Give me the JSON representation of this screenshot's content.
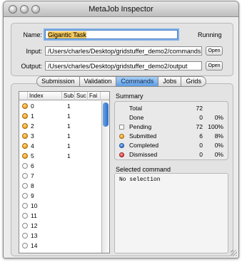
{
  "window": {
    "title": "MetaJob Inspector"
  },
  "job": {
    "name_label": "Name:",
    "name_value": "Gigantic Task",
    "status": "Running",
    "input_label": "Input:",
    "input_path": "/Users/charles/Desktop/gridstuffer_demo2/commands",
    "output_label": "Output:",
    "output_path": "/Users/charles/Desktop/gridstuffer_demo2/output",
    "open_button": "Open"
  },
  "tabs": [
    "Submission",
    "Validation",
    "Commands",
    "Jobs",
    "Grids"
  ],
  "active_tab": "Commands",
  "table": {
    "headers": [
      "Index",
      "Sub",
      "Suc",
      "Fai"
    ],
    "rows": [
      {
        "state": "submitted",
        "index": "0",
        "sub": "1"
      },
      {
        "state": "submitted",
        "index": "1",
        "sub": "1"
      },
      {
        "state": "submitted",
        "index": "2",
        "sub": "1"
      },
      {
        "state": "submitted",
        "index": "3",
        "sub": "1"
      },
      {
        "state": "submitted",
        "index": "4",
        "sub": "1"
      },
      {
        "state": "submitted",
        "index": "5",
        "sub": "1"
      },
      {
        "state": "pending",
        "index": "6",
        "sub": ""
      },
      {
        "state": "pending",
        "index": "7",
        "sub": ""
      },
      {
        "state": "pending",
        "index": "8",
        "sub": ""
      },
      {
        "state": "pending",
        "index": "9",
        "sub": ""
      },
      {
        "state": "pending",
        "index": "10",
        "sub": ""
      },
      {
        "state": "pending",
        "index": "11",
        "sub": ""
      },
      {
        "state": "pending",
        "index": "12",
        "sub": ""
      },
      {
        "state": "pending",
        "index": "13",
        "sub": ""
      },
      {
        "state": "pending",
        "index": "14",
        "sub": ""
      }
    ]
  },
  "summary": {
    "title": "Summary",
    "rows": [
      {
        "icon": "",
        "label": "Total",
        "count": "72",
        "pct": ""
      },
      {
        "icon": "",
        "label": "Done",
        "count": "0",
        "pct": "0%"
      },
      {
        "icon": "pending",
        "label": "Pending",
        "count": "72",
        "pct": "100%"
      },
      {
        "icon": "submitted",
        "label": "Submitted",
        "count": "6",
        "pct": "8%"
      },
      {
        "icon": "completed",
        "label": "Completed",
        "count": "0",
        "pct": "0%"
      },
      {
        "icon": "dismissed",
        "label": "Dismissed",
        "count": "0",
        "pct": "0%"
      }
    ]
  },
  "selected": {
    "title": "Selected command",
    "text": "No selection"
  }
}
